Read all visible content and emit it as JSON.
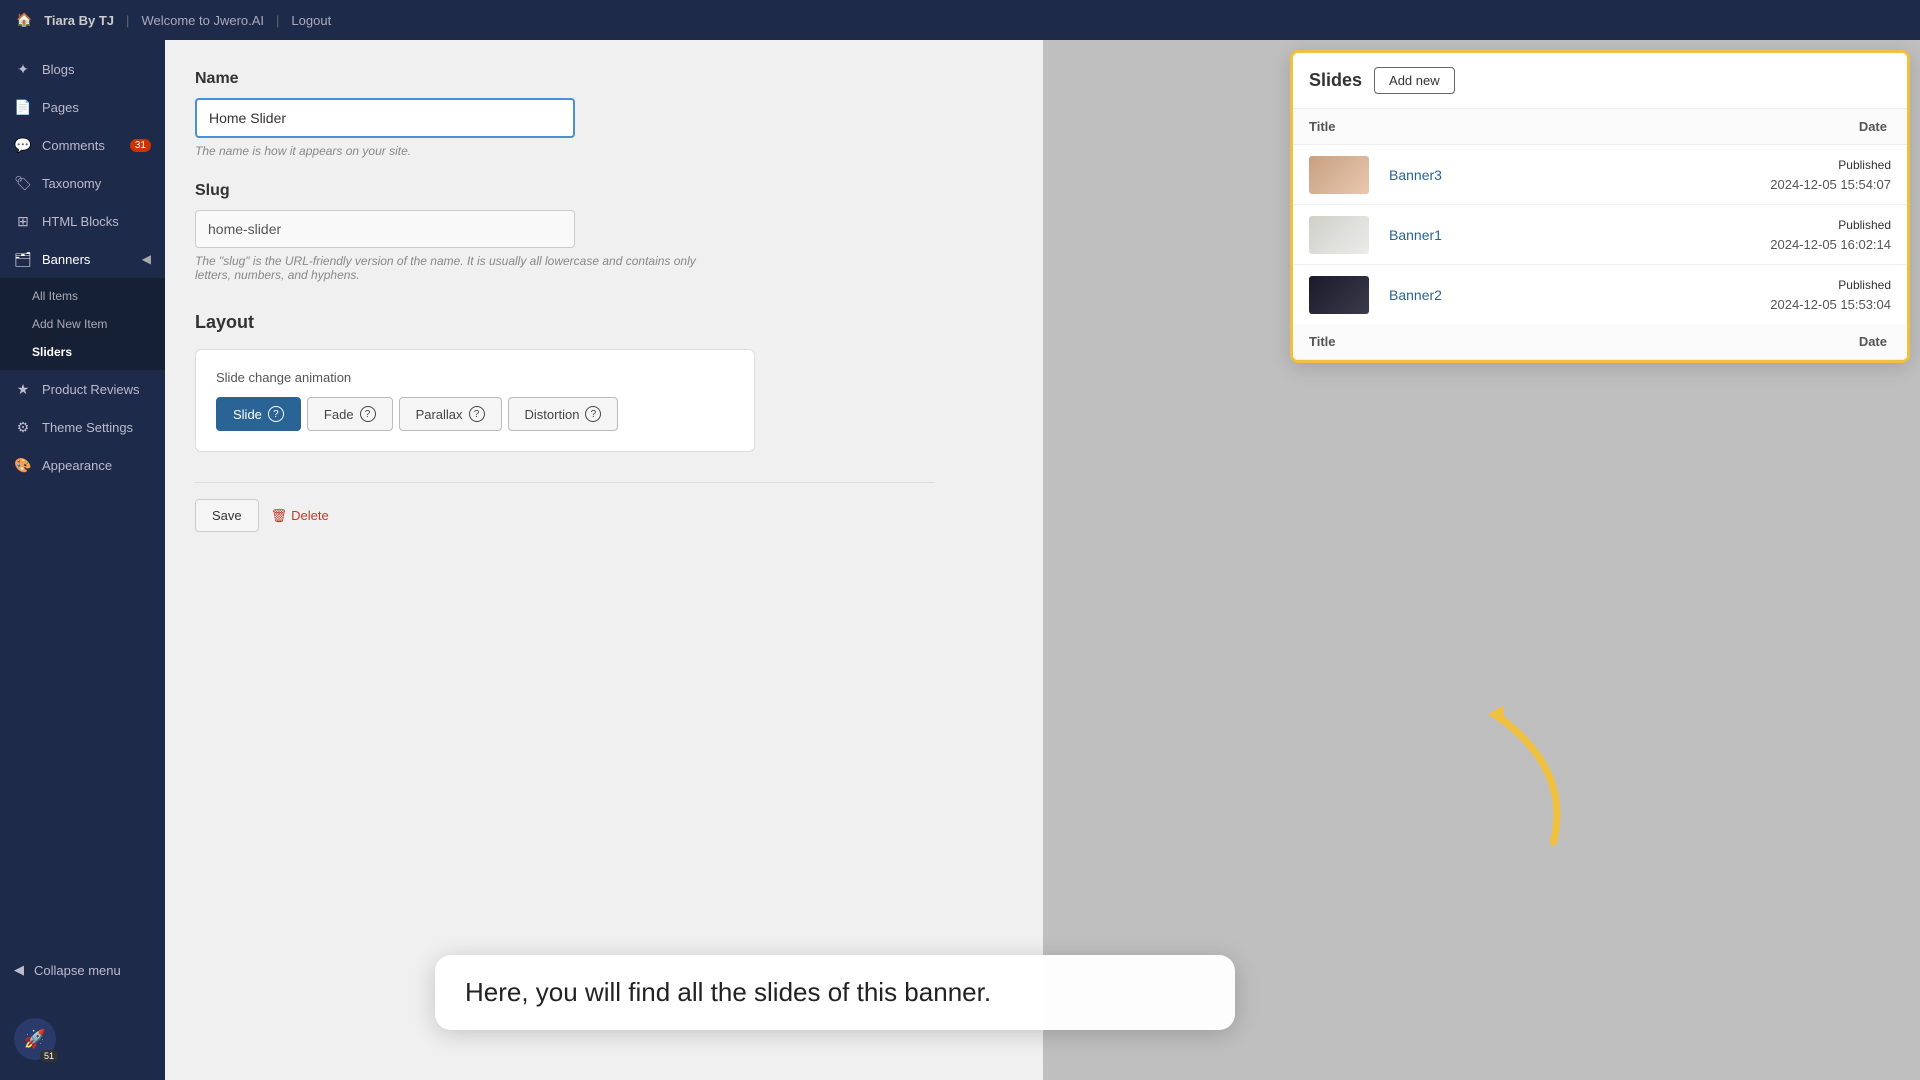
{
  "topbar": {
    "home_icon": "🏠",
    "site_name": "Tiara By TJ",
    "sep1": "|",
    "welcome_link": "Welcome to Jwero.AI",
    "sep2": "|",
    "logout_link": "Logout"
  },
  "sidebar": {
    "items": [
      {
        "id": "blogs",
        "label": "Blogs",
        "icon": "✦"
      },
      {
        "id": "pages",
        "label": "Pages",
        "icon": "📄"
      },
      {
        "id": "comments",
        "label": "Comments",
        "icon": "💬",
        "badge": "31"
      },
      {
        "id": "taxonomy",
        "label": "Taxonomy",
        "icon": "🏷"
      },
      {
        "id": "html-blocks",
        "label": "HTML Blocks",
        "icon": "⊞"
      },
      {
        "id": "banners",
        "label": "Banners",
        "icon": "🗂",
        "active": true
      }
    ],
    "banners_sub": [
      {
        "id": "all-items",
        "label": "All Items"
      },
      {
        "id": "add-new-item",
        "label": "Add New Item"
      },
      {
        "id": "sliders",
        "label": "Sliders",
        "active": true
      }
    ],
    "other_items": [
      {
        "id": "product-reviews",
        "label": "Product Reviews",
        "icon": "★"
      },
      {
        "id": "theme-settings",
        "label": "Theme Settings",
        "icon": "⚙"
      },
      {
        "id": "appearance",
        "label": "Appearance",
        "icon": "🎨"
      }
    ],
    "collapse_label": "Collapse menu",
    "avatar_icon": "🚀",
    "avatar_badge": "51"
  },
  "main": {
    "name_label": "Name",
    "name_value": "Home Slider",
    "name_hint": "The name is how it appears on your site.",
    "slug_label": "Slug",
    "slug_value": "home-slider",
    "slug_hint": "The \"slug\" is the URL-friendly version of the name. It is usually all lowercase and contains only letters, numbers, and hyphens.",
    "layout_label": "Layout",
    "anim_label": "Slide change animation",
    "anim_buttons": [
      {
        "id": "slide",
        "label": "Slide",
        "active": true
      },
      {
        "id": "fade",
        "label": "Fade",
        "active": false
      },
      {
        "id": "parallax",
        "label": "Parallax",
        "active": false
      },
      {
        "id": "distortion",
        "label": "Distortion",
        "active": false
      }
    ],
    "save_label": "Save",
    "delete_label": "Delete"
  },
  "slides_panel": {
    "title": "Slides",
    "add_new_label": "Add new",
    "col_title": "Title",
    "col_date": "Date",
    "items": [
      {
        "id": "banner3",
        "name": "Banner3",
        "status": "Published",
        "date": "2024-12-05 15:54:07",
        "thumb_color": "#c8a080"
      },
      {
        "id": "banner1",
        "name": "Banner1",
        "status": "Published",
        "date": "2024-12-05 16:02:14",
        "thumb_color": "#d0d0c8"
      },
      {
        "id": "banner2",
        "name": "Banner2",
        "status": "Published",
        "date": "2024-12-05 15:53:04",
        "thumb_color": "#2a2a3a"
      }
    ]
  },
  "tooltip": {
    "text": "Here, you will find all the slides of this banner."
  },
  "colors": {
    "accent_blue": "#2a6496",
    "sidebar_bg": "#1e2a4a",
    "arrow_color": "#f0c040"
  }
}
